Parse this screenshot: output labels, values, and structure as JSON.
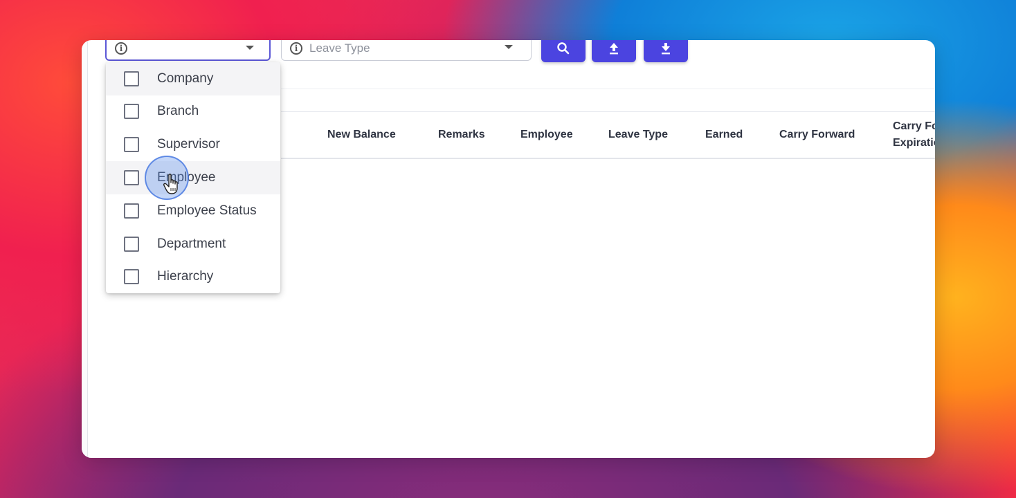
{
  "filters": {
    "first_select": {
      "placeholder": ""
    },
    "leave_type_select": {
      "placeholder": "Leave Type"
    }
  },
  "toolbar": {
    "search_icon": "search-icon",
    "upload_icon": "upload-icon",
    "download_icon": "download-icon",
    "accent_color": "#4b44e0"
  },
  "table": {
    "columns": [
      "New Balance",
      "Remarks",
      "Employee",
      "Leave Type",
      "Earned",
      "Carry Forward",
      "Carry Fo",
      "Expiratio"
    ]
  },
  "dropdown": {
    "options": [
      {
        "label": "Company",
        "checked": false
      },
      {
        "label": "Branch",
        "checked": false
      },
      {
        "label": "Supervisor",
        "checked": false
      },
      {
        "label": "Employee",
        "checked": false
      },
      {
        "label": "Employee Status",
        "checked": false
      },
      {
        "label": "Department",
        "checked": false
      },
      {
        "label": "Hierarchy",
        "checked": false
      }
    ]
  }
}
